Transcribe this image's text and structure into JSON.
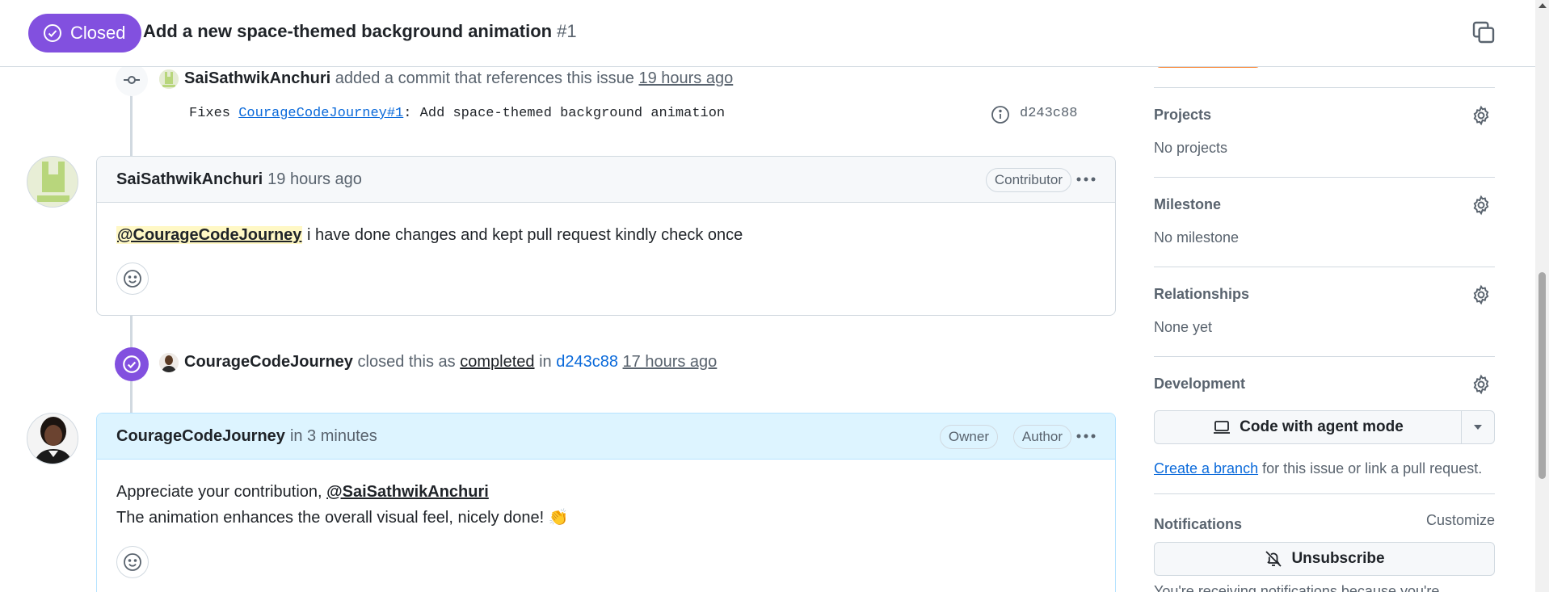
{
  "header": {
    "state_label": "Closed",
    "title": "Add a new space-themed background animation",
    "number": "#1"
  },
  "commit_event": {
    "actor": "SaiSathwikAnchuri",
    "action": "added a commit that references this issue",
    "time": "19 hours ago",
    "message_prefix": "Fixes ",
    "message_link": "CourageCodeJourney#1",
    "message_suffix": ": Add space-themed background animation",
    "sha": "d243c88"
  },
  "comment1": {
    "author": "SaiSathwikAnchuri",
    "time": "19 hours ago",
    "label": "Contributor",
    "mention": "@CourageCodeJourney",
    "body": " i have done changes and kept pull request kindly check once"
  },
  "closed_event": {
    "actor": "CourageCodeJourney",
    "text1": "closed this as",
    "reason": "completed",
    "text2": "in",
    "sha": "d243c88",
    "time": "17 hours ago"
  },
  "comment2": {
    "author": "CourageCodeJourney",
    "time": "in 3 minutes",
    "label_owner": "Owner",
    "label_author": "Author",
    "line1_text": "Appreciate your contribution, ",
    "line1_mention": "@SaiSathwikAnchuri",
    "line2": "The animation enhances the overall visual feel, nicely done! 👏"
  },
  "sidebar": {
    "projects_title": "Projects",
    "projects_value": "No projects",
    "milestone_title": "Milestone",
    "milestone_value": "No milestone",
    "relationships_title": "Relationships",
    "relationships_value": "None yet",
    "development_title": "Development",
    "agent_button": "Code with agent mode",
    "branch_link": "Create a branch",
    "branch_text": " for this issue or link a pull request.",
    "notifications_title": "Notifications",
    "customize": "Customize",
    "unsubscribe": "Unsubscribe",
    "cut_text": "You're receiving notifications because you're..."
  },
  "colors": {
    "closed_purple": "#8250df",
    "link_blue": "#0969da",
    "owner_header": "#ddf4ff",
    "mention_highlight": "#fff8c5"
  }
}
